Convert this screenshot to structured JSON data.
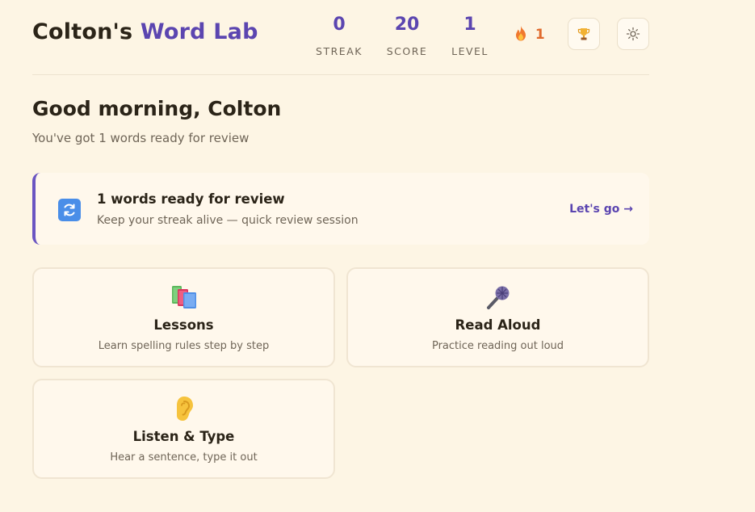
{
  "header": {
    "title_owner": "Colton's",
    "title_app": "Word Lab",
    "stats": [
      {
        "value": "0",
        "label": "STREAK"
      },
      {
        "value": "20",
        "label": "SCORE"
      },
      {
        "value": "1",
        "label": "LEVEL"
      }
    ],
    "fire_count": "1",
    "fire_icon": "fire-icon",
    "trophy_icon": "trophy-icon",
    "settings_icon": "settings-icon"
  },
  "greeting": {
    "title": "Good morning, Colton",
    "subtitle": "You've got 1 words ready for review"
  },
  "review": {
    "icon": "refresh-icon",
    "title": "1 words ready for review",
    "subtitle": "Keep your streak alive — quick review session",
    "cta": "Let's go →"
  },
  "cards": [
    {
      "icon": "books-icon",
      "title": "Lessons",
      "subtitle": "Learn spelling rules step by step"
    },
    {
      "icon": "microphone-icon",
      "title": "Read Aloud",
      "subtitle": "Practice reading out loud"
    },
    {
      "icon": "ear-icon",
      "title": "Listen & Type",
      "subtitle": "Hear a sentence, type it out"
    }
  ],
  "colors": {
    "background": "#fdf5e4",
    "accent": "#5b45b0",
    "fire": "#e06a2c",
    "card": "#fff8ec"
  }
}
